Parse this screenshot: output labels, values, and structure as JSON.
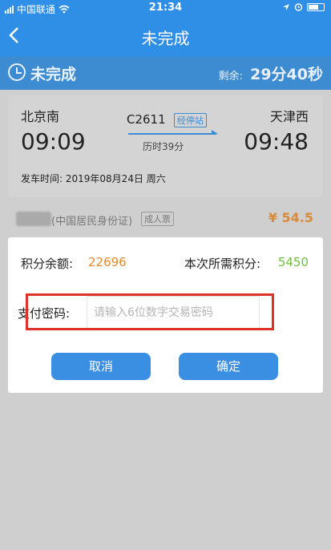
{
  "status_bar": {
    "carrier": "中国联通",
    "time": "21:34",
    "icons": [
      "signal-icon",
      "wifi-icon",
      "location-icon",
      "alarm-icon",
      "battery-icon"
    ]
  },
  "nav": {
    "title": "未完成",
    "back_icon": "chevron-left-icon"
  },
  "order": {
    "state": "未完成",
    "remain_label": "剩余:",
    "remain_time": "29分40秒"
  },
  "ticket": {
    "from_station": "北京南",
    "from_time": "09:09",
    "train_no": "C2611",
    "stop_tag": "经停站",
    "duration": "历时39分",
    "to_station": "天津西",
    "to_time": "09:48",
    "depart_label": "发车时间:",
    "depart_value": "2019年08月24日 周六"
  },
  "passenger": {
    "id_type": "(中国居民身份证)",
    "ticket_type": "成人票",
    "price": "¥ 54.5"
  },
  "dialog": {
    "points_label": "积分余额:",
    "points_value": "22696",
    "need_label": "本次所需积分:",
    "need_value": "5450",
    "password_label": "支付密码:",
    "password_placeholder": "请输入6位数字交易密码",
    "cancel_label": "取消",
    "confirm_label": "确定"
  },
  "colors": {
    "primary": "#2f8fe6",
    "points": "#e8892c",
    "need_points": "#6fbf3f",
    "highlight": "#e0302a"
  }
}
